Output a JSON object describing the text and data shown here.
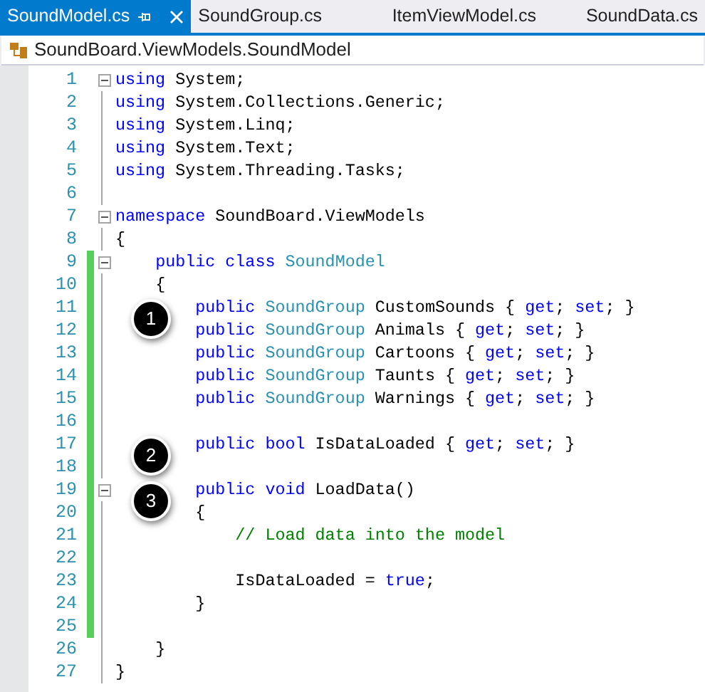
{
  "tabs": [
    {
      "label": "SoundModel.cs",
      "selected": true
    },
    {
      "label": "SoundGroup.cs",
      "selected": false
    },
    {
      "label": "ItemViewModel.cs",
      "selected": false
    },
    {
      "label": "SoundData.cs",
      "selected": false
    }
  ],
  "breadcrumb": "SoundBoard.ViewModels.SoundModel",
  "lines": [
    {
      "number": "1",
      "fold": true,
      "changed": false,
      "tokens": [
        {
          "kind": "keyword",
          "text": "using"
        },
        {
          "kind": "plain",
          "text": " System;"
        }
      ]
    },
    {
      "number": "2",
      "fold": false,
      "changed": false,
      "tokens": [
        {
          "kind": "keyword",
          "text": "using"
        },
        {
          "kind": "plain",
          "text": " System.Collections.Generic;"
        }
      ]
    },
    {
      "number": "3",
      "fold": false,
      "changed": false,
      "tokens": [
        {
          "kind": "keyword",
          "text": "using"
        },
        {
          "kind": "plain",
          "text": " System.Linq;"
        }
      ]
    },
    {
      "number": "4",
      "fold": false,
      "changed": false,
      "tokens": [
        {
          "kind": "keyword",
          "text": "using"
        },
        {
          "kind": "plain",
          "text": " System.Text;"
        }
      ]
    },
    {
      "number": "5",
      "fold": false,
      "changed": false,
      "tokens": [
        {
          "kind": "keyword",
          "text": "using"
        },
        {
          "kind": "plain",
          "text": " System.Threading.Tasks;"
        }
      ]
    },
    {
      "number": "6",
      "fold": false,
      "changed": false
    },
    {
      "number": "7",
      "fold": true,
      "changed": false,
      "tokens": [
        {
          "kind": "keyword",
          "text": "namespace"
        },
        {
          "kind": "plain",
          "text": " SoundBoard.ViewModels"
        }
      ]
    },
    {
      "number": "8",
      "fold": false,
      "changed": false,
      "tokens": [
        {
          "kind": "plain",
          "text": "{"
        }
      ]
    },
    {
      "number": "9",
      "fold": true,
      "changed": true,
      "tokens": [
        {
          "kind": "keyword",
          "text": "    public class"
        },
        {
          "kind": "type",
          "text": " SoundModel"
        }
      ]
    },
    {
      "number": "10",
      "fold": false,
      "changed": true,
      "tokens": [
        {
          "kind": "plain",
          "text": "    {"
        }
      ]
    },
    {
      "number": "11",
      "fold": false,
      "changed": true,
      "callout": "1",
      "tokens": [
        {
          "kind": "keyword",
          "text": "        public"
        },
        {
          "kind": "type",
          "text": " SoundGroup"
        },
        {
          "kind": "plain",
          "text": " CustomSounds { "
        },
        {
          "kind": "keyword",
          "text": "get"
        },
        {
          "kind": "plain",
          "text": "; "
        },
        {
          "kind": "keyword",
          "text": "set"
        },
        {
          "kind": "plain",
          "text": "; }"
        }
      ]
    },
    {
      "number": "12",
      "fold": false,
      "changed": true,
      "tokens": [
        {
          "kind": "keyword",
          "text": "        public"
        },
        {
          "kind": "type",
          "text": " SoundGroup"
        },
        {
          "kind": "plain",
          "text": " Animals { "
        },
        {
          "kind": "keyword",
          "text": "get"
        },
        {
          "kind": "plain",
          "text": "; "
        },
        {
          "kind": "keyword",
          "text": "set"
        },
        {
          "kind": "plain",
          "text": "; }"
        }
      ]
    },
    {
      "number": "13",
      "fold": false,
      "changed": true,
      "tokens": [
        {
          "kind": "keyword",
          "text": "        public"
        },
        {
          "kind": "type",
          "text": " SoundGroup"
        },
        {
          "kind": "plain",
          "text": " Cartoons { "
        },
        {
          "kind": "keyword",
          "text": "get"
        },
        {
          "kind": "plain",
          "text": "; "
        },
        {
          "kind": "keyword",
          "text": "set"
        },
        {
          "kind": "plain",
          "text": "; }"
        }
      ]
    },
    {
      "number": "14",
      "fold": false,
      "changed": true,
      "tokens": [
        {
          "kind": "keyword",
          "text": "        public"
        },
        {
          "kind": "type",
          "text": " SoundGroup"
        },
        {
          "kind": "plain",
          "text": " Taunts { "
        },
        {
          "kind": "keyword",
          "text": "get"
        },
        {
          "kind": "plain",
          "text": "; "
        },
        {
          "kind": "keyword",
          "text": "set"
        },
        {
          "kind": "plain",
          "text": "; }"
        }
      ]
    },
    {
      "number": "15",
      "fold": false,
      "changed": true,
      "tokens": [
        {
          "kind": "keyword",
          "text": "        public"
        },
        {
          "kind": "type",
          "text": " SoundGroup"
        },
        {
          "kind": "plain",
          "text": " Warnings { "
        },
        {
          "kind": "keyword",
          "text": "get"
        },
        {
          "kind": "plain",
          "text": "; "
        },
        {
          "kind": "keyword",
          "text": "set"
        },
        {
          "kind": "plain",
          "text": "; }"
        }
      ]
    },
    {
      "number": "16",
      "fold": false,
      "changed": true
    },
    {
      "number": "17",
      "fold": false,
      "changed": true,
      "callout": "2",
      "tokens": [
        {
          "kind": "keyword",
          "text": "        public bool"
        },
        {
          "kind": "plain",
          "text": " IsDataLoaded { "
        },
        {
          "kind": "keyword",
          "text": "get"
        },
        {
          "kind": "plain",
          "text": "; "
        },
        {
          "kind": "keyword",
          "text": "set"
        },
        {
          "kind": "plain",
          "text": "; }"
        }
      ]
    },
    {
      "number": "18",
      "fold": false,
      "changed": true
    },
    {
      "number": "19",
      "fold": true,
      "changed": true,
      "callout": "3",
      "tokens": [
        {
          "kind": "keyword",
          "text": "        public void"
        },
        {
          "kind": "plain",
          "text": " LoadData()"
        }
      ]
    },
    {
      "number": "20",
      "fold": false,
      "changed": true,
      "tokens": [
        {
          "kind": "plain",
          "text": "        {"
        }
      ]
    },
    {
      "number": "21",
      "fold": false,
      "changed": true,
      "tokens": [
        {
          "kind": "comment",
          "text": "            // Load data into the model"
        }
      ]
    },
    {
      "number": "22",
      "fold": false,
      "changed": true
    },
    {
      "number": "23",
      "fold": false,
      "changed": true,
      "tokens": [
        {
          "kind": "plain",
          "text": "            IsDataLoaded = "
        },
        {
          "kind": "keyword",
          "text": "true"
        },
        {
          "kind": "plain",
          "text": ";"
        }
      ]
    },
    {
      "number": "24",
      "fold": false,
      "changed": true,
      "tokens": [
        {
          "kind": "plain",
          "text": "        }"
        }
      ]
    },
    {
      "number": "25",
      "fold": false,
      "changed": true
    },
    {
      "number": "26",
      "fold": false,
      "changed": false,
      "tokens": [
        {
          "kind": "plain",
          "text": "    }"
        }
      ]
    },
    {
      "number": "27",
      "fold": false,
      "changed": false,
      "tokens": [
        {
          "kind": "plain",
          "text": "}"
        }
      ]
    }
  ]
}
